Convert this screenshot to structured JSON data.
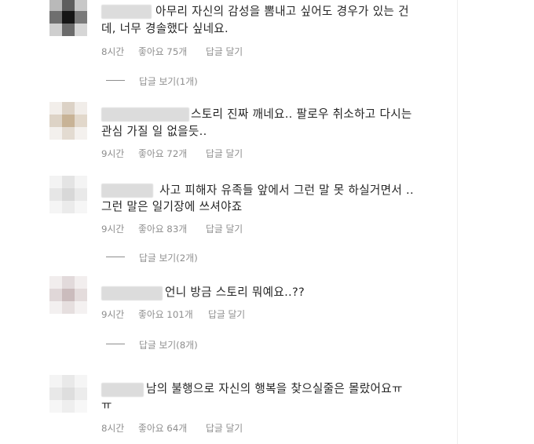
{
  "comments": [
    {
      "text_line1": "아무리 자신의 감성을 뽐내고 싶어도 경우가 있는 건",
      "text_line2": "데, 너무 경솔했다 싶네요.",
      "time": "8시간",
      "likes": "좋아요 75개",
      "reply": "답글 달기",
      "view_replies": "답글 보기(1개)"
    },
    {
      "text_line1": "스토리 진짜 깨네요.. 팔로우 취소하고 다시는",
      "text_line2": "관심 가질 일 없을듯..",
      "time": "9시간",
      "likes": "좋아요 72개",
      "reply": "답글 달기"
    },
    {
      "text_line1": "사고 피해자 유족들 앞에서 그런 말 못 하실거면서 ..",
      "text_line2": "그런 말은 일기장에 쓰셔야죠",
      "time": "9시간",
      "likes": "좋아요 83개",
      "reply": "답글 달기",
      "view_replies": "답글 보기(2개)"
    },
    {
      "text_line1": "언니 방금 스토리 뭐예요..??",
      "time": "9시간",
      "likes": "좋아요 101개",
      "reply": "답글 달기",
      "view_replies": "답글 보기(8개)"
    },
    {
      "text_line1": "남의 불행으로 자신의 행복을 찾으실줄은 몰랐어요ㅠ",
      "text_line2": "ㅠ",
      "time": "8시간",
      "likes": "좋아요 64개",
      "reply": "답글 달기"
    }
  ]
}
